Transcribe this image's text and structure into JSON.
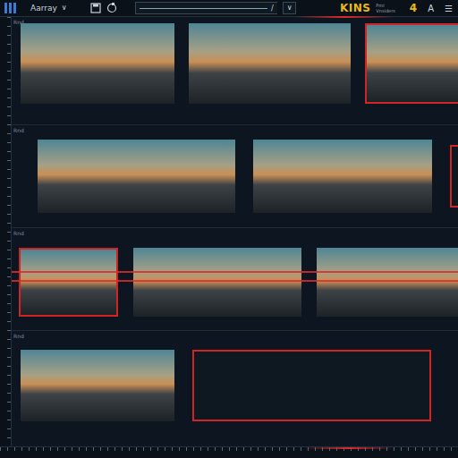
{
  "toolbar": {
    "project": "Aarray",
    "project_caret": "∨",
    "field_separator": "/",
    "field_caret": "∨",
    "brand": "KINS",
    "brand_sub": [
      "Pml",
      "Vnsiders"
    ],
    "count": "4",
    "text_tool": "A",
    "menu": "☰"
  },
  "tracks": [
    {
      "label": "Rnd",
      "marker": false,
      "clips": [
        {
          "kind": "photo",
          "selected": false
        },
        {
          "kind": "photo",
          "selected": false
        },
        {
          "kind": "photo",
          "selected": true
        }
      ]
    },
    {
      "label": "Rnd",
      "marker": false,
      "clips": [
        {
          "kind": "photo",
          "selected": false
        },
        {
          "kind": "photo",
          "selected": false
        },
        {
          "kind": "empty",
          "selected": true
        }
      ]
    },
    {
      "label": "Rnd",
      "marker": true,
      "clips": [
        {
          "kind": "photo",
          "selected": true
        },
        {
          "kind": "photo",
          "selected": false
        },
        {
          "kind": "photo",
          "selected": false
        }
      ]
    },
    {
      "label": "Rnd",
      "marker": false,
      "clips": [
        {
          "kind": "photo",
          "selected": false
        },
        {
          "kind": "empty",
          "selected": true
        }
      ]
    }
  ]
}
